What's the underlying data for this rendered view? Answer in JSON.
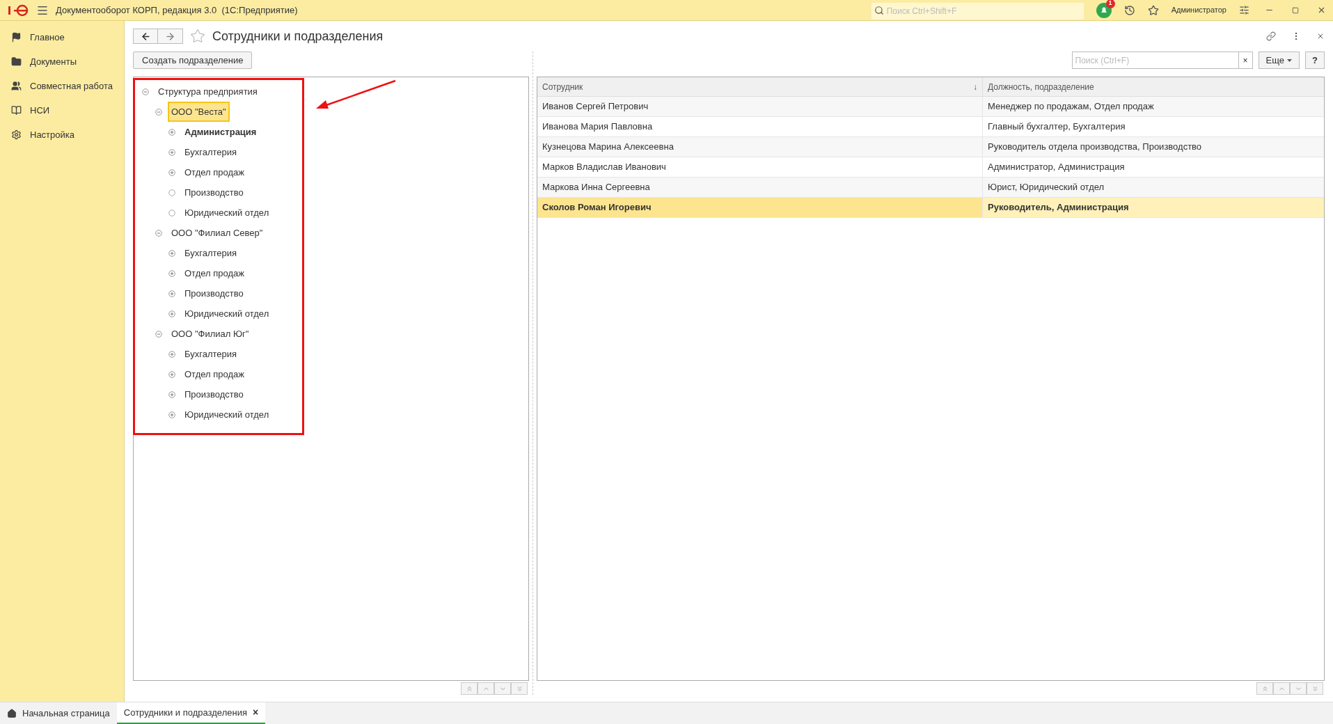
{
  "top_bar": {
    "title": "Документооборот КОРП, редакция 3.0  (1С:Предприятие)",
    "search": {
      "placeholder": "Поиск Ctrl+Shift+F"
    },
    "notifications": "1",
    "user": "Администратор"
  },
  "sidebar": {
    "items": [
      {
        "label": "Главное"
      },
      {
        "label": "Документы"
      },
      {
        "label": "Совместная работа"
      },
      {
        "label": "НСИ"
      },
      {
        "label": "Настройка"
      }
    ]
  },
  "form": {
    "title": "Сотрудники и подразделения",
    "create_button": "Создать подразделение",
    "search": {
      "placeholder": "Поиск (Ctrl+F)"
    },
    "clear": "×",
    "more_button": "Еще",
    "help_button": "?"
  },
  "tree": {
    "label": "Структура предприятия",
    "kind": "expanded",
    "selected": false,
    "bold": false,
    "children": [
      {
        "label": "ООО \"Веста\"",
        "kind": "expanded",
        "selected": true,
        "bold": false,
        "children": [
          {
            "label": "Администрация",
            "kind": "collapsed",
            "selected": false,
            "bold": true
          },
          {
            "label": "Бухгалтерия",
            "kind": "collapsed",
            "selected": false,
            "bold": false
          },
          {
            "label": "Отдел продаж",
            "kind": "collapsed",
            "selected": false,
            "bold": false
          },
          {
            "label": "Производство",
            "kind": "leaf",
            "selected": false,
            "bold": false
          },
          {
            "label": "Юридический отдел",
            "kind": "leaf",
            "selected": false,
            "bold": false
          }
        ]
      },
      {
        "label": "ООО \"Филиал Север\"",
        "kind": "expanded",
        "selected": false,
        "bold": false,
        "children": [
          {
            "label": "Бухгалтерия",
            "kind": "collapsed",
            "selected": false,
            "bold": false
          },
          {
            "label": "Отдел продаж",
            "kind": "collapsed",
            "selected": false,
            "bold": false
          },
          {
            "label": "Производство",
            "kind": "collapsed",
            "selected": false,
            "bold": false
          },
          {
            "label": "Юридический отдел",
            "kind": "collapsed",
            "selected": false,
            "bold": false
          }
        ]
      },
      {
        "label": "ООО \"Филиал Юг\"",
        "kind": "expanded",
        "selected": false,
        "bold": false,
        "children": [
          {
            "label": "Бухгалтерия",
            "kind": "collapsed",
            "selected": false,
            "bold": false
          },
          {
            "label": "Отдел продаж",
            "kind": "collapsed",
            "selected": false,
            "bold": false
          },
          {
            "label": "Производство",
            "kind": "collapsed",
            "selected": false,
            "bold": false
          },
          {
            "label": "Юридический отдел",
            "kind": "collapsed",
            "selected": false,
            "bold": false
          }
        ]
      }
    ]
  },
  "table": {
    "columns": [
      "Сотрудник",
      "Должность, подразделение"
    ],
    "sort_mark": "↓",
    "rows": [
      {
        "employee": "Иванов Сергей Петрович",
        "position": "Менеджер по продажам, Отдел продаж",
        "selected": false
      },
      {
        "employee": "Иванова Мария Павловна",
        "position": "Главный бухгалтер, Бухгалтерия",
        "selected": false
      },
      {
        "employee": "Кузнецова Марина Алексеевна",
        "position": "Руководитель отдела производства, Производство",
        "selected": false
      },
      {
        "employee": "Марков Владислав Иванович",
        "position": "Администратор, Администрация",
        "selected": false
      },
      {
        "employee": "Маркова Инна Сергеевна",
        "position": "Юрист, Юридический отдел",
        "selected": false
      },
      {
        "employee": "Сколов Роман Игоревич",
        "position": "Руководитель, Администрация",
        "selected": true
      }
    ]
  },
  "open_tabs": [
    {
      "label": "Начальная страница",
      "kind": "home",
      "selected": false
    },
    {
      "label": "Сотрудники и подразделения",
      "kind": "page",
      "selected": true,
      "close": "×"
    }
  ]
}
